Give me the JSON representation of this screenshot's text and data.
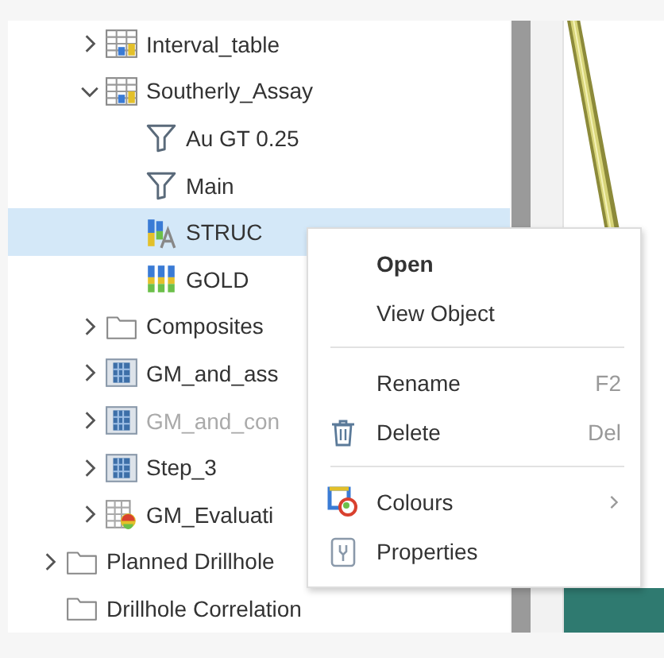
{
  "tree": {
    "nested_items": [
      {
        "label": "Interval_table",
        "kind": "table",
        "expanded": false,
        "selected": false,
        "disabled": false
      },
      {
        "label": "Southerly_Assay",
        "kind": "table",
        "expanded": true,
        "selected": false,
        "disabled": false,
        "children": [
          {
            "label": "Au GT 0.25",
            "kind": "filter",
            "selected": false,
            "disabled": false
          },
          {
            "label": "Main",
            "kind": "filter",
            "selected": false,
            "disabled": false
          },
          {
            "label": "STRUC",
            "kind": "category",
            "selected": true,
            "disabled": false
          },
          {
            "label": "GOLD",
            "kind": "numeric",
            "selected": false,
            "disabled": false
          }
        ]
      },
      {
        "label": "Composites",
        "kind": "folder",
        "expanded": false,
        "selected": false,
        "disabled": false
      },
      {
        "label": "GM_and_ass",
        "kind": "block_model",
        "expanded": false,
        "selected": false,
        "disabled": false
      },
      {
        "label": "GM_and_con",
        "kind": "block_model",
        "expanded": false,
        "selected": false,
        "disabled": true
      },
      {
        "label": "Step_3",
        "kind": "block_model",
        "expanded": false,
        "selected": false,
        "disabled": false
      },
      {
        "label": "GM_Evaluati",
        "kind": "evaluation",
        "expanded": false,
        "selected": false,
        "disabled": false
      }
    ],
    "items": [
      {
        "label": "Planned Drillhole",
        "kind": "folder",
        "expanded": false,
        "selected": false,
        "disabled": false
      },
      {
        "label": "Drillhole Correlation",
        "kind": "folder",
        "selected": false,
        "disabled": false
      }
    ]
  },
  "context_menu": {
    "items": [
      {
        "kind": "item",
        "label": "Open",
        "default": true
      },
      {
        "kind": "item",
        "label": "View Object",
        "default": false
      },
      {
        "kind": "separator"
      },
      {
        "kind": "item",
        "label": "Rename",
        "shortcut": "F2",
        "default": false
      },
      {
        "kind": "delete",
        "label": "Delete",
        "shortcut": "Del",
        "default": false
      },
      {
        "kind": "separator"
      },
      {
        "kind": "colours",
        "label": "Colours",
        "submenu": true,
        "default": false
      },
      {
        "kind": "properties",
        "label": "Properties",
        "default": false
      }
    ]
  }
}
